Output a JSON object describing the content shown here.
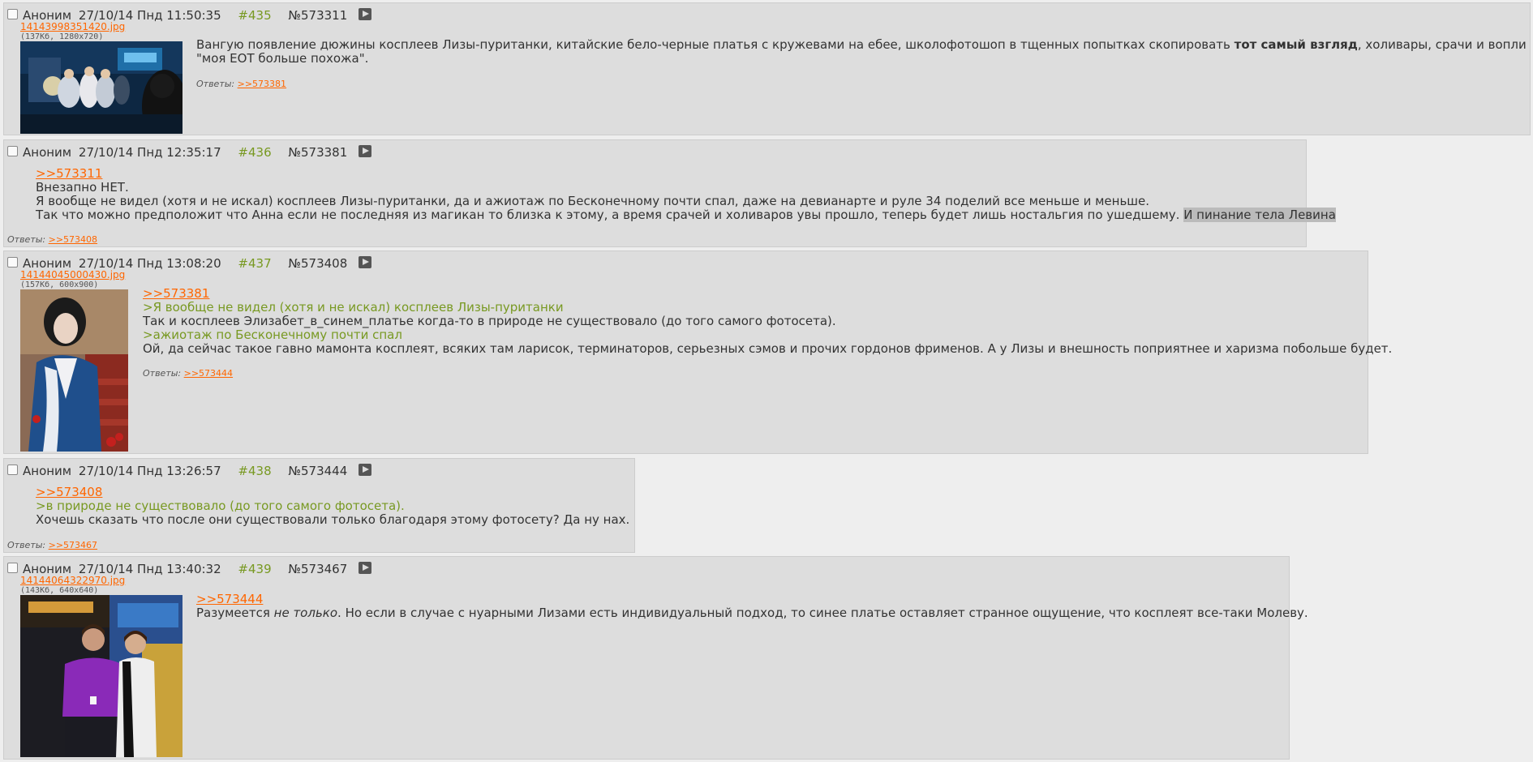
{
  "colors": {
    "background": "#eeeeee",
    "post_background": "#dddddd",
    "quote_green": "#789922",
    "link_orange": "#ff6600",
    "text": "#333333"
  },
  "posts": [
    {
      "name": "Аноним",
      "date": "27/10/14 Пнд 11:50:35",
      "num": "#435",
      "id": "№573311",
      "file": {
        "name": "14143998351420.jpg",
        "info": "(137Кб, 1280x720)"
      },
      "body": {
        "text1": "Вангую появление дюжины косплеев Лизы-пуританки, китайские бело-черные платья с кружевами на ебее, школофотошоп в тщенных попытках скопировать ",
        "bold": "тот самый взгляд",
        "text2": ", холивары, срачи и вопли",
        "line2": "\"моя ЕОТ больше похожа\"."
      },
      "replies_label": "Ответы:",
      "replies": ">>573381"
    },
    {
      "name": "Аноним",
      "date": "27/10/14 Пнд 12:35:17",
      "num": "#436",
      "id": "№573381",
      "body": {
        "link": ">>573311",
        "line1": "Внезапно НЕТ.",
        "line2": "Я вообще не видел (хотя и не искал) косплеев Лизы-пуританки, да и ажиотаж по Бесконечному почти спал, даже на девианарте и руле 34 поделий все меньше и меньше.",
        "line3": "Так что можно предположит что Анна если не последняя из магикан то близка к этому, а время срачей и холиваров увы прошло, теперь будет лишь ностальгия по ушедшему. ",
        "line3_highlight": "И пинание тела Левина"
      },
      "replies_label": "Ответы:",
      "replies": ">>573408"
    },
    {
      "name": "Аноним",
      "date": "27/10/14 Пнд 13:08:20",
      "num": "#437",
      "id": "№573408",
      "file": {
        "name": "14144045000430.jpg",
        "info": "(157Кб, 600x900)"
      },
      "body": {
        "link": ">>573381",
        "quote1": ">Я вообще не видел (хотя и не искал) косплеев Лизы-пуританки",
        "line1": "Так и косплеев Элизабет_в_синем_платье когда-то в природе не существовало (до того самого фотосета).",
        "quote2": ">ажиотаж по Бесконечному почти спал",
        "line2": "Ой, да сейчас такое гавно мамонта косплеят, всяких там ларисок, терминаторов, серьезных сэмов и прочих гордонов фрименов. А у Лизы и внешность поприятнее и харизма побольше будет."
      },
      "replies_label": "Ответы:",
      "replies": ">>573444"
    },
    {
      "name": "Аноним",
      "date": "27/10/14 Пнд 13:26:57",
      "num": "#438",
      "id": "№573444",
      "body": {
        "link": ">>573408",
        "quote1": ">в природе не существовало (до того самого фотосета).",
        "line1": "Хочешь сказать что после они существовали только благодаря этому фотосету? Да ну нах."
      },
      "replies_label": "Ответы:",
      "replies": ">>573467"
    },
    {
      "name": "Аноним",
      "date": "27/10/14 Пнд 13:40:32",
      "num": "#439",
      "id": "№573467",
      "file": {
        "name": "14144064322970.jpg",
        "info": "(143Кб, 640x640)"
      },
      "body": {
        "link": ">>573444",
        "text1": "Разумеется ",
        "italic": "не только",
        "text2": ". Но если в случае с нуарными Лизами есть индивидуальный подход, то синее платье оставляет странное ощущение, что косплеят все-таки Молеву."
      }
    }
  ]
}
